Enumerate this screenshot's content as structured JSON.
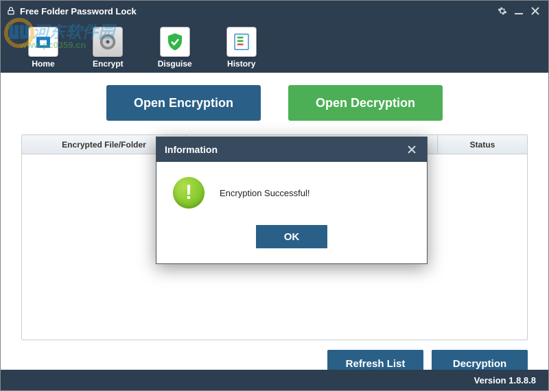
{
  "window": {
    "title": "Free Folder Password Lock"
  },
  "nav": {
    "home": "Home",
    "encrypt": "Encrypt",
    "disguise": "Disguise",
    "history": "History"
  },
  "actions": {
    "open_encryption": "Open Encryption",
    "open_decryption": "Open Decryption"
  },
  "table": {
    "col_file": "Encrypted File/Folder",
    "col_status": "Status"
  },
  "buttons": {
    "refresh": "Refresh List",
    "decryption": "Decryption"
  },
  "footer": {
    "version_label": "Version 1.8.8.8"
  },
  "dialog": {
    "title": "Information",
    "message": "Encryption Successful!",
    "ok": "OK"
  },
  "watermark": {
    "line1": "河东软件园",
    "line2": "www.pc0359.cn"
  }
}
